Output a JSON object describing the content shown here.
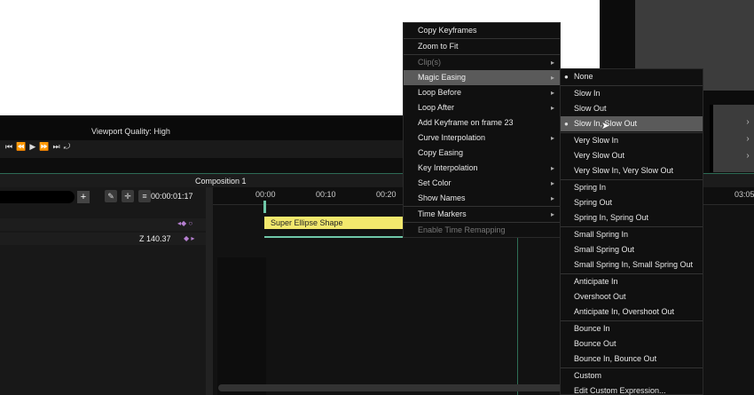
{
  "viewport": {
    "quality_label": "Viewport Quality: High"
  },
  "transport": {
    "buttons": [
      "⏮",
      "⏪",
      "▶",
      "⏩",
      "⏭",
      "⤾"
    ]
  },
  "composition": {
    "title": "Composition 1"
  },
  "layers": {
    "add_label": "+",
    "timecode": "00:00:01:17",
    "z_label": "Z",
    "z_value": "140.37"
  },
  "timeline": {
    "ruler": [
      "00:00",
      "00:10",
      "00:20",
      "03:05"
    ],
    "layer_name": "Super Ellipse Shape"
  },
  "context_menu": {
    "items": [
      {
        "label": "Copy Keyframes",
        "submenu": false,
        "disabled": false
      },
      {
        "label": "Zoom to Fit",
        "submenu": false,
        "disabled": false
      },
      {
        "label": "Clip(s)",
        "submenu": true,
        "disabled": true
      },
      {
        "label": "Magic Easing",
        "submenu": true,
        "disabled": false,
        "active": true
      },
      {
        "label": "Loop Before",
        "submenu": true,
        "disabled": false
      },
      {
        "label": "Loop After",
        "submenu": true,
        "disabled": false
      },
      {
        "label": "Add Keyframe on frame 23",
        "submenu": false,
        "disabled": false
      },
      {
        "label": "Curve Interpolation",
        "submenu": true,
        "disabled": false
      },
      {
        "label": "Copy Easing",
        "submenu": false,
        "disabled": false
      },
      {
        "label": "Key Interpolation",
        "submenu": true,
        "disabled": false
      },
      {
        "label": "Set Color",
        "submenu": true,
        "disabled": false
      },
      {
        "label": "Show Names",
        "submenu": true,
        "disabled": false
      },
      {
        "label": "Time Markers",
        "submenu": true,
        "disabled": false
      },
      {
        "label": "Enable Time Remapping",
        "submenu": false,
        "disabled": true
      }
    ]
  },
  "easing_menu": {
    "items": [
      "None",
      "Slow In",
      "Slow Out",
      "Slow In, Slow Out",
      "Very Slow In",
      "Very Slow Out",
      "Very Slow In, Very Slow Out",
      "Spring In",
      "Spring Out",
      "Spring In, Spring Out",
      "Small Spring In",
      "Small Spring Out",
      "Small Spring In, Small Spring Out",
      "Anticipate In",
      "Overshoot Out",
      "Anticipate In, Overshoot Out",
      "Bounce In",
      "Bounce Out",
      "Bounce In, Bounce Out",
      "Custom",
      "Edit Custom Expression..."
    ],
    "selected": "None",
    "hovered": "Slow In, Slow Out"
  },
  "colors": {
    "accent": "#6fc7a8",
    "layer_bar": "#f2e86d",
    "keyframe": "#b57fd0"
  }
}
